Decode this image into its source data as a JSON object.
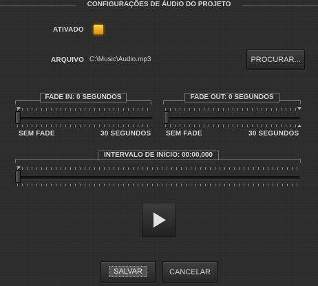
{
  "header": {
    "title": "CONFIGURAÇÕES DE ÁUDIO DO PROJETO"
  },
  "enabled": {
    "label": "ATIVADO",
    "checked": true
  },
  "file": {
    "label": "ARQUIVO",
    "path": "C:\\Music\\Audio.mp3",
    "browse_label": "PROCURAR..."
  },
  "fade_in": {
    "title": "FADE IN: 0 SEGUNDOS",
    "min_label": "SEM FADE",
    "max_label": "30 SEGUNDOS",
    "value_seconds": 0,
    "max_seconds": 30
  },
  "fade_out": {
    "title": "FADE OUT: 0 SEGUNDOS",
    "min_label": "SEM FADE",
    "max_label": "30 SEGUNDOS",
    "value_seconds": 0,
    "max_seconds": 30
  },
  "start_interval": {
    "title": "INTERVALO DE INÍCIO: 00:00,000",
    "value_fraction": 0
  },
  "play": {
    "icon": "play-icon"
  },
  "actions": {
    "save_label": "SALVAR",
    "cancel_label": "CANCELAR"
  }
}
